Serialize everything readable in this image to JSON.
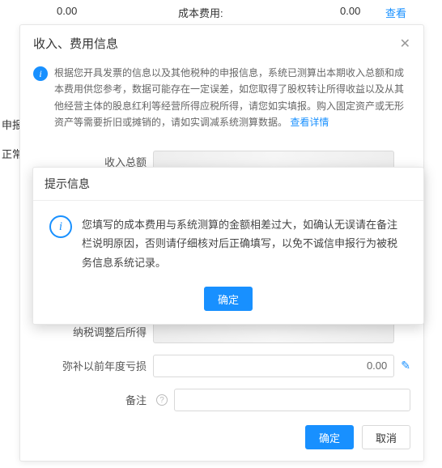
{
  "bg": {
    "amount_left": "0.00",
    "cost_label": "成本费用:",
    "cost_value": "0.00",
    "view_link": "查看",
    "side1": "申报",
    "side2": "正常"
  },
  "modal": {
    "title": "收入、费用信息",
    "info_text": "根据您开具发票的信息以及其他税种的申报信息，系统已测算出本期收入总额和成本费用供您参考，数据可能存在一定误差，如您取得了股权转让所得收益以及从其他经营主体的股息红利等经营所得应税所得，请您如实填报。购入固定资产或无形资产等需要折旧或摊销的，请如实调减系统测算数据。",
    "info_link": "查看详情",
    "fields": {
      "income_total_label": "收入总额",
      "adjusted_income_label": "纳税调整后所得",
      "loss_offset_label": "弥补以前年度亏损",
      "loss_offset_value": "0.00",
      "remark_label": "备注"
    },
    "buttons": {
      "ok": "确定",
      "cancel": "取消"
    }
  },
  "alert": {
    "title": "提示信息",
    "text": "您填写的成本费用与系统测算的金额相差过大，如确认无误请在备注栏说明原因，否则请仔细核对后正确填写，以免不诚信申报行为被税务信息系统记录。",
    "ok": "确定"
  }
}
